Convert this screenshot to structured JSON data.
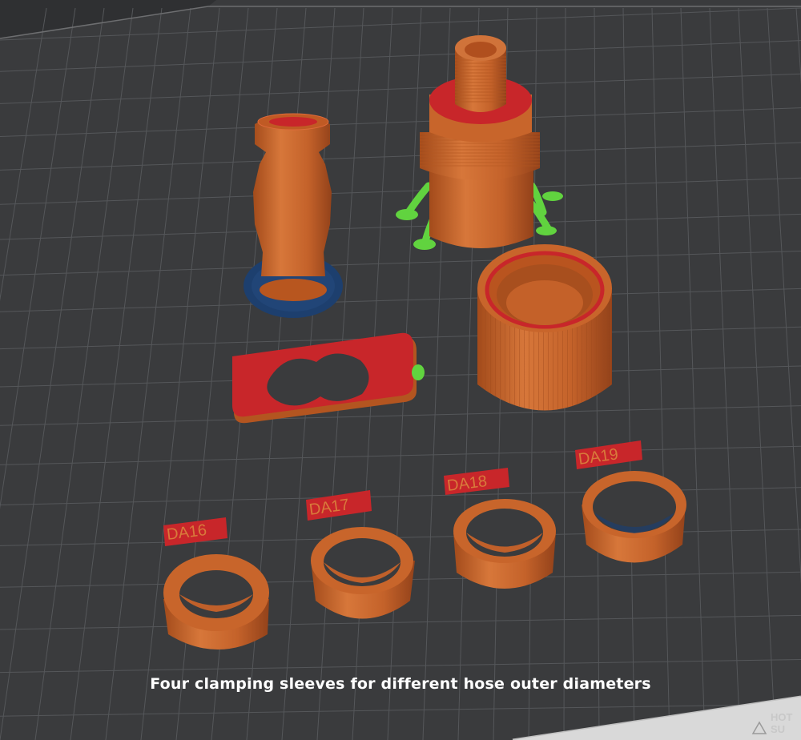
{
  "viewport": {
    "background": "#3a3b3d",
    "grid_color": "#55575a",
    "plate_edge": "#d9d9d9"
  },
  "caption": "Four clamping sleeves for different hose outer diameters",
  "sleeve_labels": [
    "DA16",
    "DA17",
    "DA18",
    "DA19"
  ],
  "plate_logo": {
    "line1": "HOT",
    "line2": "SU",
    "icon": "heatbed-icon"
  },
  "colors": {
    "model_orange": "#c8652b",
    "model_dark": "#a84f1e",
    "top_red": "#c8262a",
    "support_green": "#61d33f",
    "brim_blue": "#1d3f6e"
  }
}
